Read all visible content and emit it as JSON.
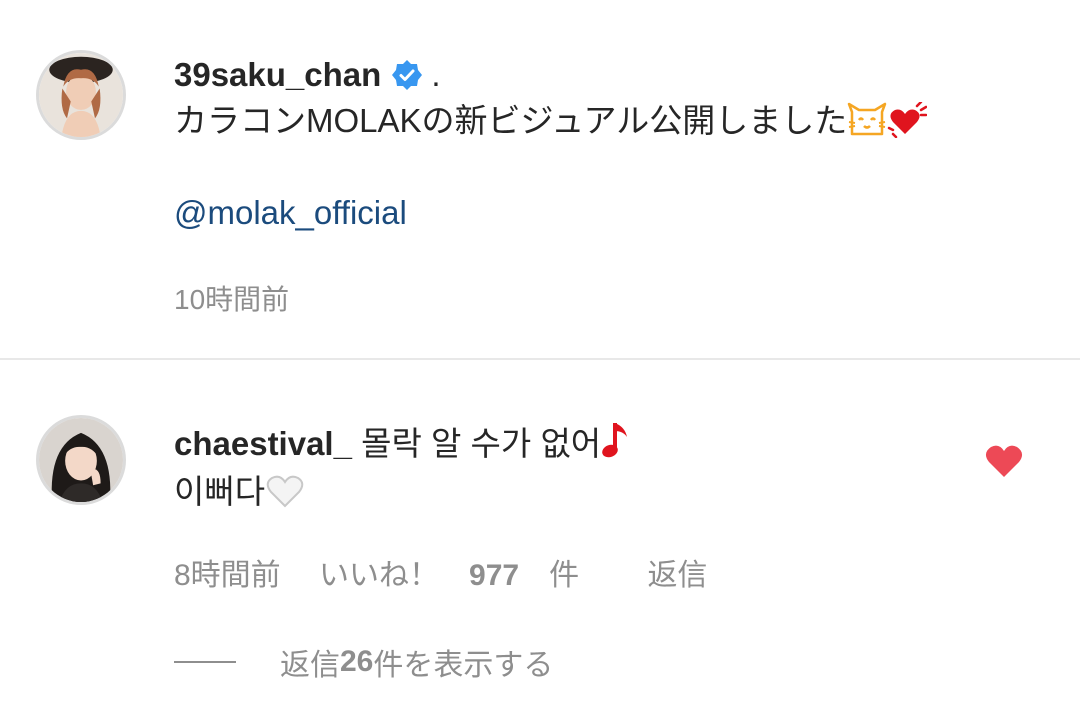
{
  "post": {
    "username": "39saku_chan",
    "dot": ".",
    "caption": "カラコンMOLAKの新ビジュアル公開しました",
    "mention": "@molak_official",
    "time": "10時間前"
  },
  "comment": {
    "username": "chaestival_",
    "text_line1": "몰락 알 수가 없어",
    "text_line2": "이뻐다",
    "time": "8時間前",
    "likes_prefix": "いいね！",
    "likes_count": "977",
    "likes_suffix": "件",
    "reply_label": "返信",
    "view_replies_prefix": "返信",
    "view_replies_count": "26",
    "view_replies_suffix": "件を表示する"
  },
  "icons": {
    "verified": "verified-badge-icon",
    "like": "heart-icon",
    "liked_color": "#ed4956",
    "verified_color": "#3897f0",
    "mention_color": "#1b4b7d"
  }
}
